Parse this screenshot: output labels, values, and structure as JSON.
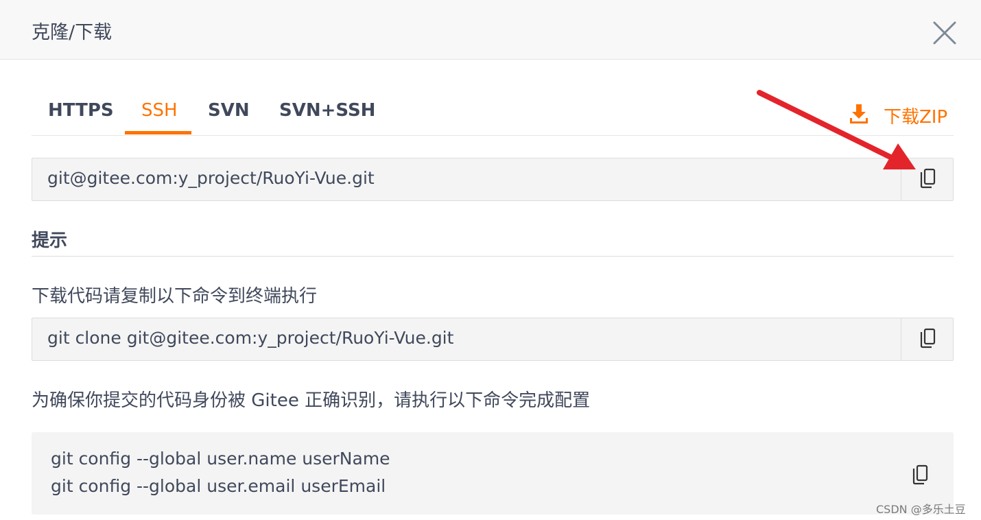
{
  "dialog": {
    "title": "克隆/下载",
    "close_icon": "close-icon"
  },
  "tabs": [
    {
      "label": "HTTPS",
      "active": false
    },
    {
      "label": "SSH",
      "active": true
    },
    {
      "label": "SVN",
      "active": false
    },
    {
      "label": "SVN+SSH",
      "active": false
    }
  ],
  "download_zip": {
    "label": "下载ZIP",
    "icon": "download-icon"
  },
  "repo_url": {
    "value": "git@gitee.com:y_project/RuoYi-Vue.git",
    "copy_icon": "copy-icon"
  },
  "tips": {
    "title": "提示",
    "clone_hint": "下载代码请复制以下命令到终端执行",
    "clone_command": "git clone git@gitee.com:y_project/RuoYi-Vue.git",
    "config_hint": "为确保你提交的代码身份被 Gitee 正确识别，请执行以下命令完成配置",
    "config_lines": [
      "git config --global user.name userName",
      "git config --global user.email userEmail"
    ]
  },
  "annotation": {
    "arrow_icon": "red-arrow-annotation"
  },
  "watermark": "CSDN @多乐土豆",
  "colors": {
    "accent": "#fe7300",
    "text": "#40485b",
    "field_bg": "#f4f4f4",
    "arrow": "#e3242b"
  }
}
